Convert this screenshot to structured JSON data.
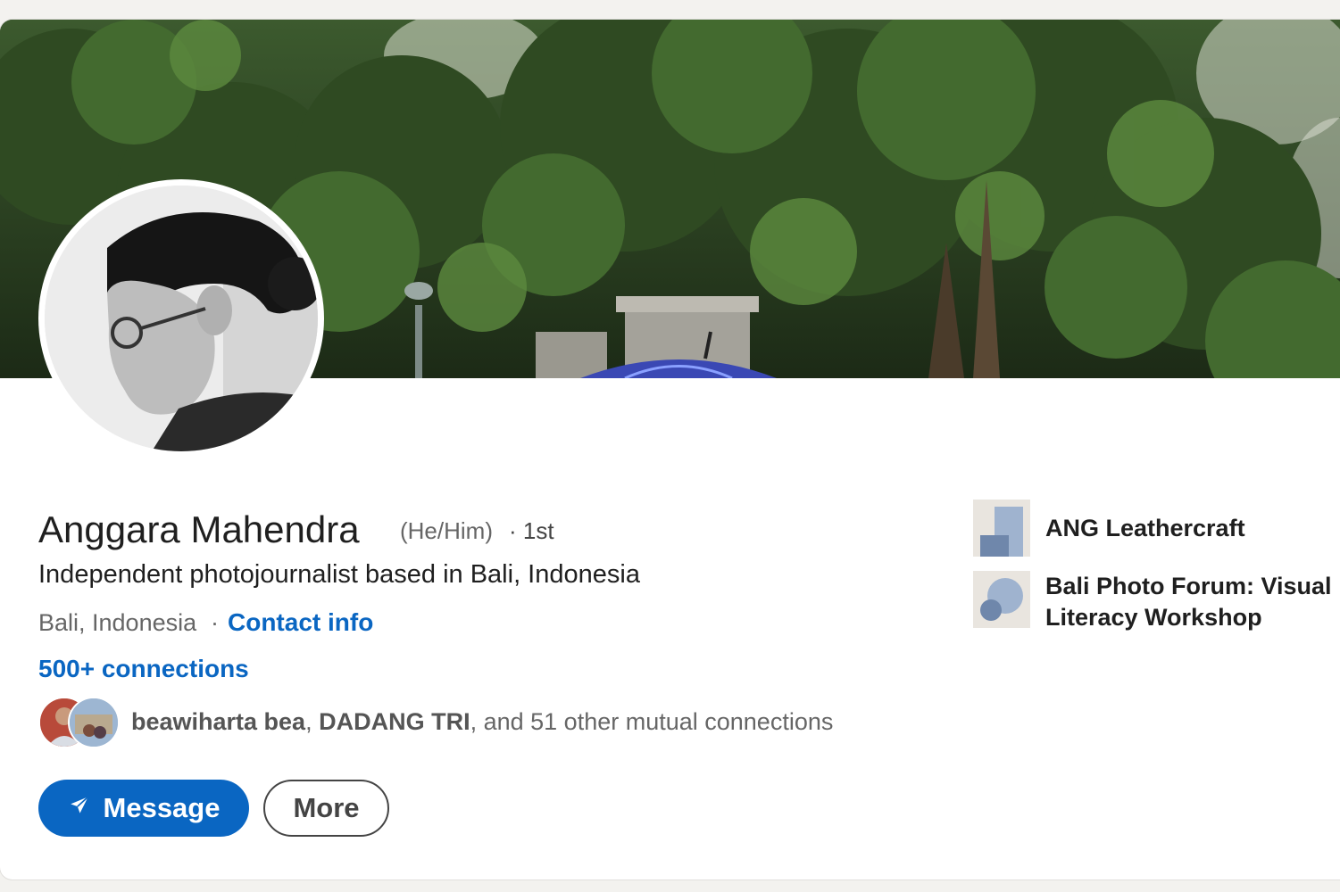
{
  "profile": {
    "name": "Anggara Mahendra",
    "pronouns": "(He/Him)",
    "degree": "· 1st",
    "headline": "Independent photojournalist based in Bali, Indonesia",
    "location": "Bali, Indonesia",
    "location_sep": "·",
    "contact_info": "Contact info",
    "connections": "500+ connections"
  },
  "mutual": {
    "name1": "beawiharta bea",
    "sep1": ", ",
    "name2": "DADANG TRI",
    "rest": ", and 51 other mutual connections"
  },
  "actions": {
    "message": "Message",
    "more": "More"
  },
  "organizations": [
    {
      "name": "ANG Leathercraft",
      "icon": "company-logo-icon"
    },
    {
      "name": "Bali Photo Forum: Visual Literacy Workshop",
      "icon": "school-logo-icon"
    }
  ],
  "colors": {
    "accent": "#0a66c2",
    "background": "#f3f2ef"
  }
}
